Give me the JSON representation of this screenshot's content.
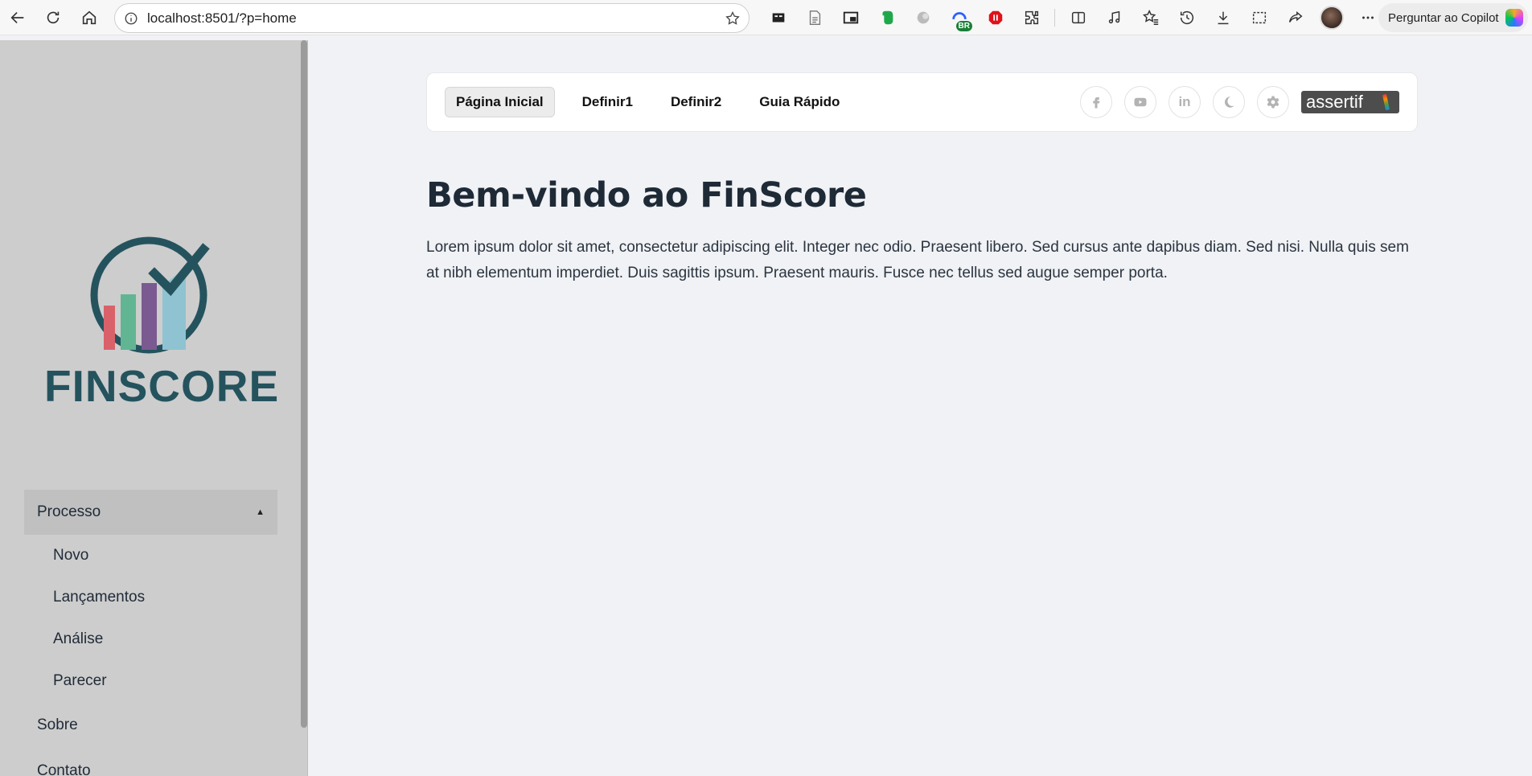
{
  "browser": {
    "url": "localhost:8501/?p=home",
    "copilot_label": "Perguntar ao Copilot",
    "ext_badge": "BR"
  },
  "sidebar": {
    "logo_text": "FINSCORE",
    "logo_colors": [
      "#24535e",
      "#d9626a",
      "#62b592",
      "#7a5a91",
      "#8fc3d1"
    ],
    "menu": {
      "group_label": "Processo",
      "sub_items": [
        "Novo",
        "Lançamentos",
        "Análise",
        "Parecer"
      ],
      "items": [
        "Sobre",
        "Contato"
      ]
    }
  },
  "navbar": {
    "tabs": [
      "Página Inicial",
      "Definir1",
      "Definir2",
      "Guia Rápido"
    ],
    "active_tab": "Página Inicial",
    "social_icons": [
      "facebook-icon",
      "youtube-icon",
      "linkedin-icon",
      "moon-icon",
      "gear-icon"
    ],
    "linkedin_glyph": "in",
    "brand": "assertif"
  },
  "main": {
    "title": "Bem-vindo ao FinScore",
    "body": "Lorem ipsum dolor sit amet, consectetur adipiscing elit. Integer nec odio. Praesent libero. Sed cursus ante dapibus diam. Sed nisi. Nulla quis sem at nibh elementum imperdiet. Duis sagittis ipsum. Praesent mauris. Fusce nec tellus sed augue semper porta."
  }
}
